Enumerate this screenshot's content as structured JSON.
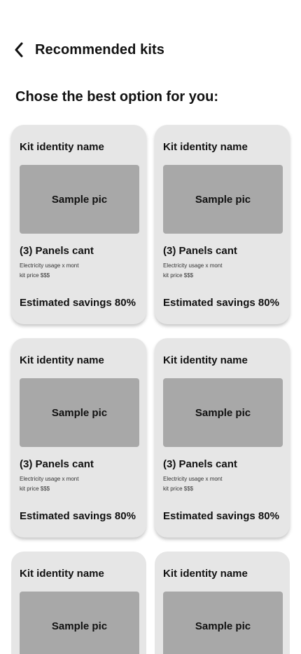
{
  "header": {
    "title": "Recommended kits",
    "back_icon": "chevron-left-icon"
  },
  "subtitle": "Chose the best option for you:",
  "colors": {
    "card_bg": "#e6e6e6",
    "image_placeholder": "#a8a8a8",
    "text": "#111111"
  },
  "kits": [
    {
      "name": "Kit identity name",
      "image_label": "Sample pic",
      "panels": "(3) Panels cant",
      "usage": "Electricity usage x mont",
      "price": "kit price $$$",
      "savings": "Estimated savings 80%"
    },
    {
      "name": "Kit identity name",
      "image_label": "Sample pic",
      "panels": "(3) Panels cant",
      "usage": "Electricity usage x mont",
      "price": "kit price $$$",
      "savings": "Estimated savings 80%"
    },
    {
      "name": "Kit identity name",
      "image_label": "Sample pic",
      "panels": "(3) Panels cant",
      "usage": "Electricity usage x mont",
      "price": "kit price $$$",
      "savings": "Estimated savings 80%"
    },
    {
      "name": "Kit identity name",
      "image_label": "Sample pic",
      "panels": "(3) Panels cant",
      "usage": "Electricity usage x mont",
      "price": "kit price $$$",
      "savings": "Estimated savings 80%"
    },
    {
      "name": "Kit identity name",
      "image_label": "Sample pic"
    },
    {
      "name": "Kit identity name",
      "image_label": "Sample pic"
    }
  ]
}
